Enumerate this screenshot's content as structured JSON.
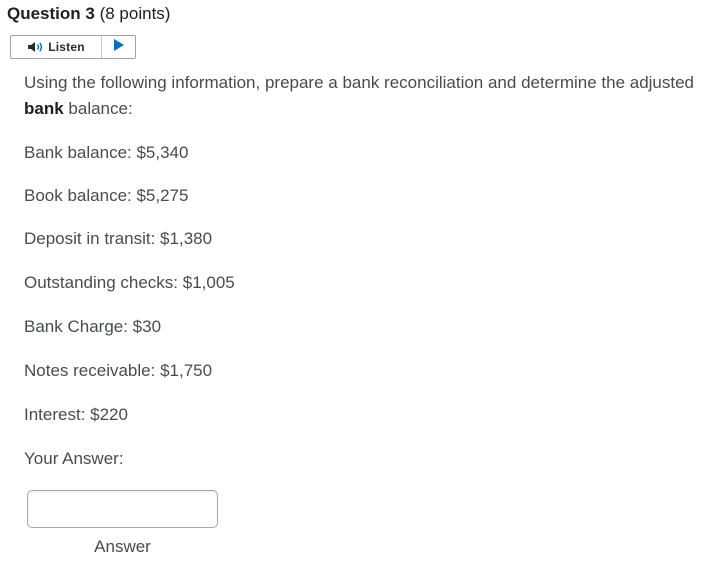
{
  "question": {
    "title": "Question 3",
    "points": "(8 points)"
  },
  "listen": {
    "label": "Listen",
    "speaker_icon": "speaker-icon",
    "play_icon": "play-icon",
    "accent_color": "#006fbf"
  },
  "prompt": {
    "before": "Using the following information, prepare a bank reconciliation and determine the adjusted ",
    "bold": "bank",
    "after": " balance:"
  },
  "info_lines": [
    "Bank balance: $5,340",
    "Book balance: $5,275",
    "Deposit in transit: $1,380",
    "Outstanding checks: $1,005",
    "Bank Charge: $30",
    "Notes receivable: $1,750",
    "Interest: $220"
  ],
  "answer": {
    "label": "Your Answer:",
    "value": "",
    "caption": "Answer"
  }
}
